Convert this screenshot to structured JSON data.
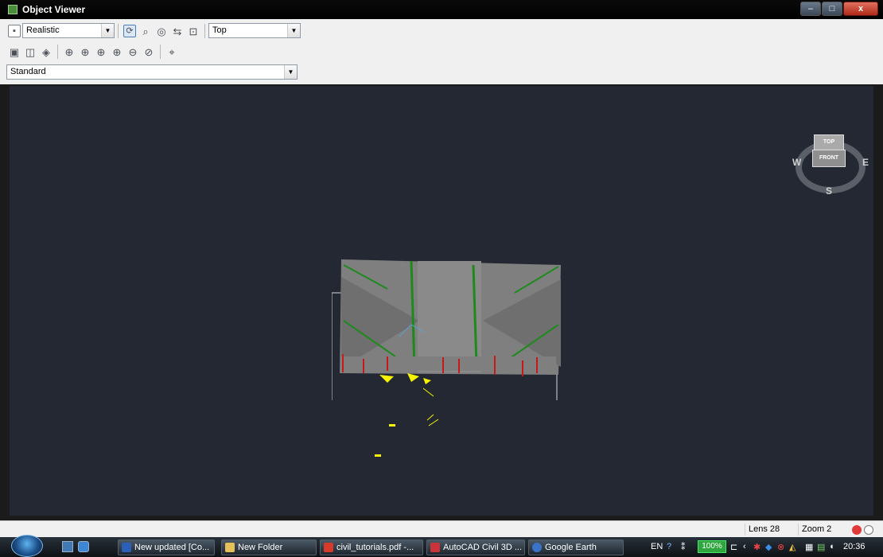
{
  "window": {
    "title": "Object Viewer",
    "controls": [
      "–",
      "□",
      "x"
    ]
  },
  "toolbar": {
    "visual_style": "Realistic",
    "view_direction": "Top",
    "display_mode": "Standard"
  },
  "viewcube": {
    "top": "TOP",
    "front": "FRONT",
    "west": "W",
    "east": "E",
    "south": "S"
  },
  "status": {
    "lens": "Lens 28",
    "zoom": "Zoom 2"
  },
  "taskbar": {
    "tasks": [
      {
        "label": "New updated [Co...",
        "icon": "word-icon"
      },
      {
        "label": "New Folder",
        "icon": "folder-icon"
      },
      {
        "label": "civil_tutorials.pdf -...",
        "icon": "pdf-icon"
      },
      {
        "label": "AutoCAD Civil 3D ...",
        "icon": "autocad-icon"
      },
      {
        "label": "Google Earth",
        "icon": "google-earth-icon"
      }
    ],
    "tray": {
      "language": "EN",
      "battery": "100%",
      "time": "20:36"
    }
  },
  "colors": {
    "viewport_bg": "#232833",
    "model_gray": "#808080",
    "accent_green": "#1e8a1e",
    "accent_red": "#c41a1a",
    "accent_yellow": "#f6f400"
  }
}
